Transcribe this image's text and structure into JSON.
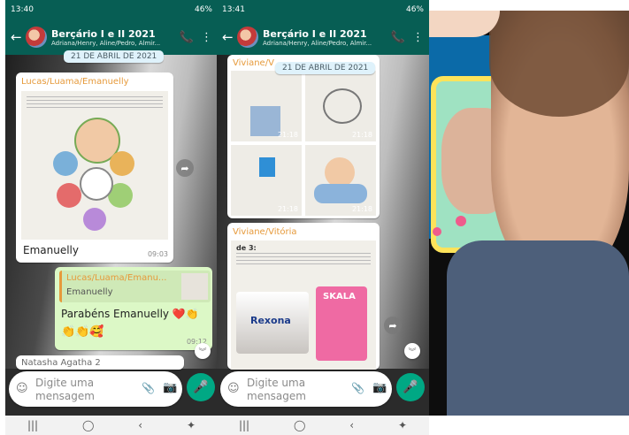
{
  "panel1": {
    "status": {
      "time": "13:40",
      "battery": "46%"
    },
    "chat": {
      "title": "Berçário I e II 2021",
      "subtitle": "Adriana/Henry, Aline/Pedro, Almir..."
    },
    "date_chip": "21 DE ABRIL DE 2021",
    "msg1": {
      "sender": "Lucas/Luama/Emanuelly",
      "caption": "Emanuelly",
      "time": "09:03"
    },
    "msg2": {
      "reply_sender": "Lucas/Luama/Emanu...",
      "reply_text": "Emanuelly",
      "text": "Parabéns Emanuelly ❤️👏",
      "emojis": "👏👏🥰",
      "time": "09:12"
    },
    "msg3": {
      "sender": "Natasha Agatha 2"
    },
    "input": {
      "placeholder_line1": "Digite uma",
      "placeholder_line2": "mensagem"
    }
  },
  "panel2": {
    "status": {
      "time": "13:41",
      "battery": "46%"
    },
    "chat": {
      "title": "Berçário I e II 2021",
      "subtitle": "Adriana/Henry, Aline/Pedro, Almir..."
    },
    "date_chip": "21 DE ABRIL DE 2021",
    "album": {
      "sender_partial": "Viviane/V",
      "times": [
        "21:18",
        "21:18",
        "21:18",
        "21:18"
      ]
    },
    "msg2": {
      "sender": "Viviane/Vitória",
      "doc_heading": "de 3:",
      "brand1": "Rexona",
      "brand2": "SKALA"
    },
    "input": {
      "placeholder_line1": "Digite uma",
      "placeholder_line2": "mensagem"
    }
  },
  "icons": {
    "back": "←",
    "call": "📞",
    "menu": "⋮",
    "emoji": "☺",
    "clip": "📎",
    "camera": "📷",
    "mic": "🎤",
    "forward": "➦",
    "down": "︾",
    "nav": [
      "|||",
      "◯",
      "‹",
      "✦"
    ]
  },
  "colors": {
    "whatsapp_green": "#075e54",
    "accent": "#00a884",
    "outgoing_bubble": "#dcf8c6",
    "sender_orange": "#e69a3b"
  }
}
